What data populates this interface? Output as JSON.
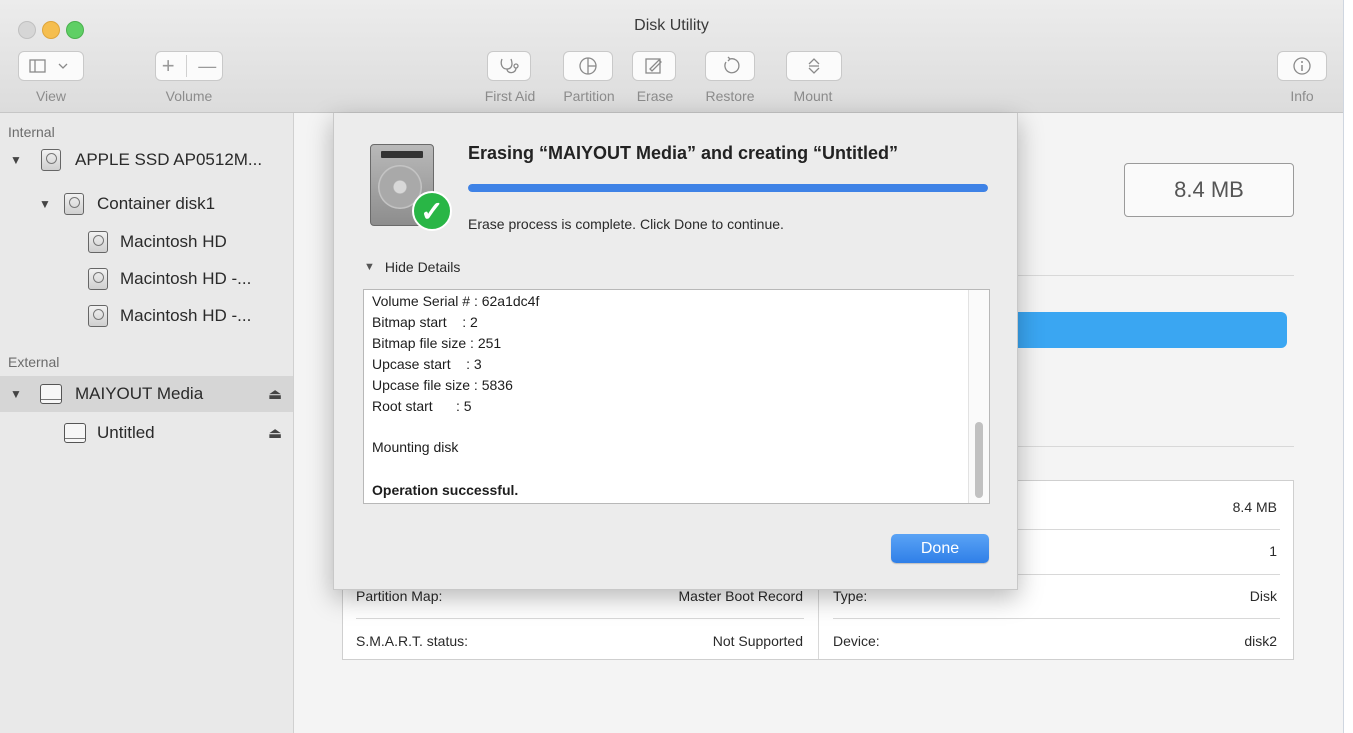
{
  "window": {
    "title": "Disk Utility"
  },
  "toolbar": {
    "view_label": "View",
    "volume_label": "Volume",
    "volume_add": "+",
    "volume_remove": "—",
    "first_aid": "First Aid",
    "partition": "Partition",
    "erase": "Erase",
    "restore": "Restore",
    "mount": "Mount",
    "info": "Info"
  },
  "sidebar": {
    "internal_header": "Internal",
    "external_header": "External",
    "internal_items": [
      {
        "label": "APPLE SSD AP0512M..."
      },
      {
        "label": "Container disk1"
      },
      {
        "label": "Macintosh HD"
      },
      {
        "label": "Macintosh HD -..."
      },
      {
        "label": "Macintosh HD -..."
      }
    ],
    "external_items": [
      {
        "label": "MAIYOUT Media"
      },
      {
        "label": "Untitled"
      }
    ]
  },
  "main": {
    "capacity": "8.4 MB",
    "info_rows": [
      {
        "left_label": "",
        "left_value": "",
        "right_label": "",
        "right_value": "8.4 MB"
      },
      {
        "left_label": "",
        "left_value": "",
        "right_label": "",
        "right_value": "1"
      },
      {
        "left_label": "Partition Map:",
        "left_value": "Master Boot Record",
        "right_label": "Type:",
        "right_value": "Disk"
      },
      {
        "left_label": "S.M.A.R.T. status:",
        "left_value": "Not Supported",
        "right_label": "Device:",
        "right_value": "disk2"
      }
    ]
  },
  "sheet": {
    "title": "Erasing “MAIYOUT Media” and creating “Untitled”",
    "progress": 1.0,
    "status": "Erase process is complete. Click Done to continue.",
    "details_toggle": "Hide Details",
    "log_lines": [
      "Volume Serial # : 62a1dc4f",
      "Bitmap start    : 2",
      "Bitmap file size : 251",
      "Upcase start    : 3",
      "Upcase file size : 5836",
      "Root start      : 5",
      "",
      "Mounting disk",
      "",
      "Operation successful."
    ],
    "done_button": "Done"
  },
  "colors": {
    "accent": "#3e82e6",
    "usage_bar": "#3aa6f2",
    "success": "#29b646"
  }
}
